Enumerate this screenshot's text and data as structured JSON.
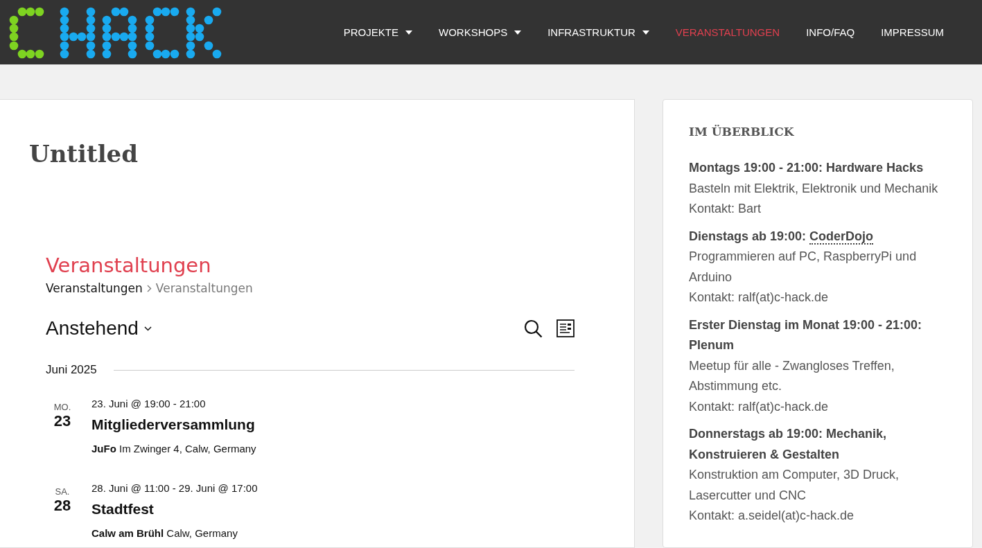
{
  "nav": {
    "items": [
      {
        "label": "PROJEKTE",
        "has_menu": true,
        "selected": false
      },
      {
        "label": "WORKSHOPS",
        "has_menu": true,
        "selected": false
      },
      {
        "label": "INFRASTRUKTUR",
        "has_menu": true,
        "selected": false
      },
      {
        "label": "VERANSTALTUNGEN",
        "has_menu": false,
        "selected": true
      },
      {
        "label": "INFO/FAQ",
        "has_menu": false,
        "selected": false
      },
      {
        "label": "IMPRESSUM",
        "has_menu": false,
        "selected": false
      }
    ]
  },
  "page": {
    "title": "Untitled",
    "events": {
      "heading": "Veranstaltungen",
      "breadcrumb": [
        "Veranstaltungen",
        "Veranstaltungen"
      ],
      "view": "Anstehend",
      "month": "Juni 2025",
      "items": [
        {
          "weekday": "MO.",
          "day": "23",
          "time": "23. Juni @ 19:00 - 21:00",
          "title": "Mitgliederversammlung",
          "venue": "JuFo",
          "address": "Im Zwinger 4, Calw, Germany"
        },
        {
          "weekday": "SA.",
          "day": "28",
          "time": "28. Juni @ 11:00 - 29. Juni @ 17:00",
          "title": "Stadtfest",
          "venue": "Calw am Brühl",
          "address": "Calw, Germany"
        }
      ]
    }
  },
  "sidebar": {
    "title": "IM ÜBERBLICK",
    "entries": [
      {
        "heading": "Montags 19:00 - 21:00: Hardware Hacks",
        "lines": [
          "Basteln mit Elektrik, Elektronik und Mechanik",
          "Kontakt: Bart"
        ]
      },
      {
        "heading": "Dienstags ab 19:00: ",
        "link": "CoderDojo",
        "lines": [
          "Programmieren auf PC, RaspberryPi und Arduino",
          "Kontakt: ralf(at)c-hack.de"
        ]
      },
      {
        "heading": "Erster Dienstag im Monat 19:00 - 21:00: Plenum",
        "lines": [
          "Meetup für alle - Zwangloses Treffen, Abstimmung etc.",
          "Kontakt: ralf(at)c-hack.de"
        ]
      },
      {
        "heading": "Donnerstags ab 19:00: Mechanik, Konstruieren & Gestalten",
        "lines": [
          "Konstruktion am Computer, 3D Druck, Lasercutter und CNC",
          "Kontakt: a.seidel(at)c-hack.de"
        ]
      }
    ]
  }
}
